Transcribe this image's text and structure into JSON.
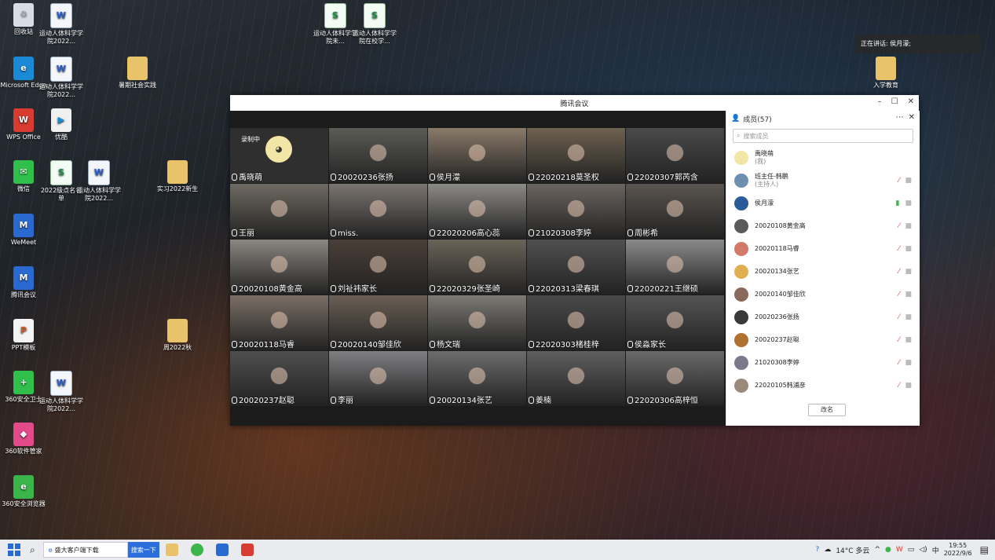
{
  "desktop": {
    "icons": [
      {
        "label": "回收站",
        "type": "bin",
        "glyph": "♲"
      },
      {
        "label": "运动人体科学学院2022...",
        "type": "word",
        "glyph": "W"
      },
      {
        "label": "Microsoft Edge",
        "type": "edge",
        "glyph": "e"
      },
      {
        "label": "运动人体科学学院2022...",
        "type": "word",
        "glyph": "W"
      },
      {
        "label": "暑期社会实践",
        "type": "folder",
        "glyph": ""
      },
      {
        "label": "WPS Office",
        "type": "wps",
        "glyph": "W"
      },
      {
        "label": "优酷",
        "type": "youku",
        "glyph": "▶"
      },
      {
        "label": "微信",
        "type": "wechat",
        "glyph": "✉"
      },
      {
        "label": "2022级点名名单",
        "type": "sheet",
        "glyph": "S"
      },
      {
        "label": "运动人体科学学院2022...",
        "type": "word",
        "glyph": "W"
      },
      {
        "label": "实习2022新生",
        "type": "folder",
        "glyph": ""
      },
      {
        "label": "WeMeet",
        "type": "wemeet",
        "glyph": "M"
      },
      {
        "label": "腾讯会议",
        "type": "wemeet",
        "glyph": "M"
      },
      {
        "label": "PPT模板",
        "type": "ppt",
        "glyph": "P"
      },
      {
        "label": "周2022秋",
        "type": "folder",
        "glyph": ""
      },
      {
        "label": "360安全卫士",
        "type": "360",
        "glyph": "+"
      },
      {
        "label": "运动人体科学学院2022...",
        "type": "word",
        "glyph": "W"
      },
      {
        "label": "360软件管家",
        "type": "360s",
        "glyph": "◆"
      },
      {
        "label": "360安全浏览器",
        "type": "360b",
        "glyph": "e"
      },
      {
        "label": "运动人体科学学院未...",
        "type": "sheet",
        "glyph": "S"
      },
      {
        "label": "运动人体科学学院在校学...",
        "type": "sheet",
        "glyph": "S"
      },
      {
        "label": "入学教育",
        "type": "folder",
        "glyph": ""
      }
    ],
    "speaking": "正在讲话: 侯月濛;"
  },
  "meeting": {
    "title": "腾讯会议",
    "recording": "录制中",
    "tiles": [
      {
        "name": "禹晓萌",
        "scene": "#2f2f2f",
        "mic": false
      },
      {
        "name": "20020236张扬",
        "scene": "#5a5b55",
        "mic": true
      },
      {
        "name": "侯月濛",
        "scene": "#8a7a6a",
        "mic": true,
        "active": true
      },
      {
        "name": "22020218莫圣权",
        "scene": "#6e6250",
        "mic": true
      },
      {
        "name": "22020307郭芮含",
        "scene": "#4a4a4a",
        "mic": true
      },
      {
        "name": "王丽",
        "scene": "#6f6a62",
        "mic": true
      },
      {
        "name": "miss.",
        "scene": "#7b7570",
        "mic": true
      },
      {
        "name": "22020206高心蕊",
        "scene": "#8c8a87",
        "mic": true
      },
      {
        "name": "21020308李婷",
        "scene": "#6b6560",
        "mic": true
      },
      {
        "name": "周彬希",
        "scene": "#5a5550",
        "mic": true
      },
      {
        "name": "20020108黄金高",
        "scene": "#8a8680",
        "mic": true
      },
      {
        "name": "刘祉祎家长",
        "scene": "#4a3f38",
        "mic": true
      },
      {
        "name": "22020329张圣崎",
        "scene": "#6a6358",
        "mic": true
      },
      {
        "name": "22020313梁春琪",
        "scene": "#505050",
        "mic": true
      },
      {
        "name": "22020221王继硕",
        "scene": "#8a8a8a",
        "mic": true
      },
      {
        "name": "20020118马睿",
        "scene": "#7a6f66",
        "mic": true
      },
      {
        "name": "20020140邹佳欣",
        "scene": "#6a5f55",
        "mic": true
      },
      {
        "name": "杨文瑞",
        "scene": "#7c7a74",
        "mic": true
      },
      {
        "name": "22020303楮桂梓",
        "scene": "#4a4a4a",
        "mic": true
      },
      {
        "name": "侯淼家长",
        "scene": "#555555",
        "mic": true
      },
      {
        "name": "20020237赵聪",
        "scene": "#4f4f4f",
        "mic": true
      },
      {
        "name": "李丽",
        "scene": "#7f7f82",
        "mic": true
      },
      {
        "name": "20020134张艺",
        "scene": "#6d6d6d",
        "mic": true
      },
      {
        "name": "姜楠",
        "scene": "#5f5f5f",
        "mic": true
      },
      {
        "name": "22020306高梓恒",
        "scene": "#6a6a6a",
        "mic": true
      }
    ]
  },
  "members_panel": {
    "title": "成员(57)",
    "search_placeholder": "搜索成员",
    "rename_label": "改名",
    "members": [
      {
        "name": "禹晓萌",
        "sub": "(我)",
        "avatar": "#f1e6a6",
        "mic": "none"
      },
      {
        "name": "班主任-韩鹏",
        "sub": "(主持人)",
        "avatar": "#6f8fb0",
        "mic": "off"
      },
      {
        "name": "侯月濛",
        "sub": "",
        "avatar": "#2a5a9a",
        "mic": "on"
      },
      {
        "name": "20020108黄金高",
        "sub": "",
        "avatar": "#5a5a5a",
        "mic": "off"
      },
      {
        "name": "20020118马睿",
        "sub": "",
        "avatar": "#d27a6a",
        "mic": "off"
      },
      {
        "name": "20020134张艺",
        "sub": "",
        "avatar": "#e0b050",
        "mic": "off"
      },
      {
        "name": "20020140邹佳欣",
        "sub": "",
        "avatar": "#8a6a5a",
        "mic": "off"
      },
      {
        "name": "20020236张扬",
        "sub": "",
        "avatar": "#3a3a3a",
        "mic": "off"
      },
      {
        "name": "20020237赵聪",
        "sub": "",
        "avatar": "#b07030",
        "mic": "off"
      },
      {
        "name": "21020308李婷",
        "sub": "",
        "avatar": "#7a7a8a",
        "mic": "off"
      },
      {
        "name": "22020105韩浦彦",
        "sub": "",
        "avatar": "#9a8a7a",
        "mic": "off"
      }
    ]
  },
  "taskbar": {
    "search_text": "盛大客户端下载",
    "search_button": "搜索一下",
    "weather": "14°C 多云",
    "ime": "中",
    "time": "19:55",
    "date": "2022/9/6"
  }
}
